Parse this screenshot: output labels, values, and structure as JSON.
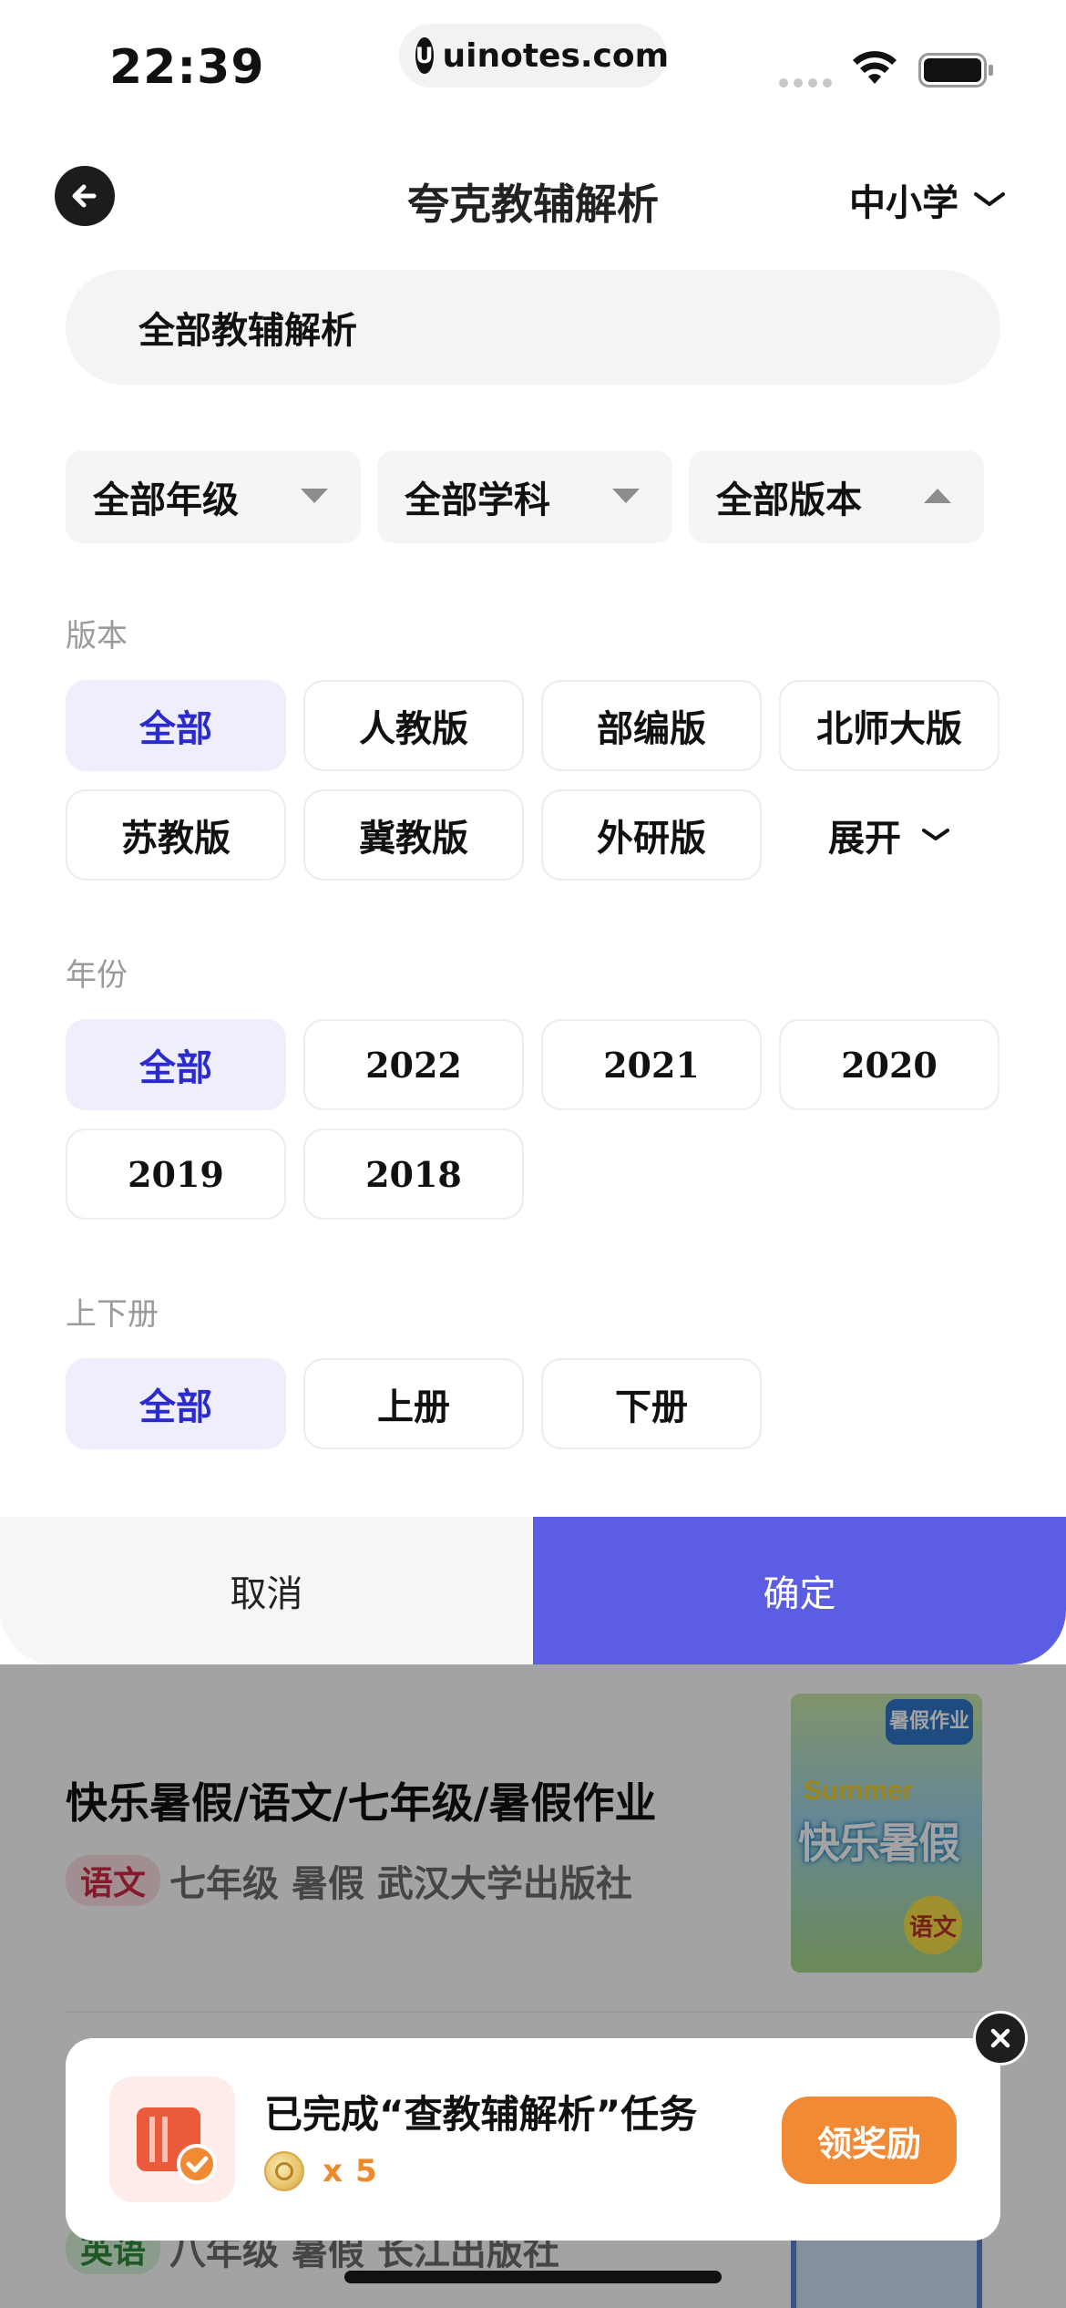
{
  "status_bar": {
    "time": "22:39",
    "url": "uinotes.com"
  },
  "header": {
    "title": "夸克教辅解析",
    "level": "中小学"
  },
  "search": {
    "text": "全部教辅解析"
  },
  "filters": {
    "grade": "全部年级",
    "subject": "全部学科",
    "edition": "全部版本"
  },
  "edition_section": {
    "label": "版本",
    "options": [
      "全部",
      "人教版",
      "部编版",
      "北师大版",
      "苏教版",
      "冀教版",
      "外研版"
    ],
    "selected": "全部",
    "expand_label": "展开"
  },
  "year_section": {
    "label": "年份",
    "options": [
      "全部",
      "2022",
      "2021",
      "2020",
      "2019",
      "2018"
    ],
    "selected": "全部"
  },
  "volume_section": {
    "label": "上下册",
    "options": [
      "全部",
      "上册",
      "下册"
    ],
    "selected": "全部"
  },
  "actions": {
    "cancel": "取消",
    "confirm": "确定"
  },
  "results": [
    {
      "title": "快乐暑假/语文/七年级/暑假作业",
      "tag": "语文",
      "meta": "七年级 暑假 武汉大学出版社",
      "cover": {
        "badge": "暑假作业",
        "line1": "Summer",
        "line2": "快乐暑假",
        "chip": "语文"
      }
    },
    {
      "tag": "英语",
      "meta": "八年级 暑假 长江出版社"
    }
  ],
  "toast": {
    "text": "已完成“查教辅解析”任务",
    "reward_x": "x",
    "reward_count": "5",
    "button": "领奖励"
  },
  "colors": {
    "accent": "#5b5de3",
    "selected_chip_bg": "#eeeefc",
    "selected_chip_text": "#2a2acf",
    "reward_orange": "#f08a34"
  },
  "icons": [
    "back-arrow-icon",
    "chevron-down-icon",
    "wifi-icon",
    "battery-icon",
    "close-icon",
    "reward-task-icon",
    "coin-icon"
  ]
}
